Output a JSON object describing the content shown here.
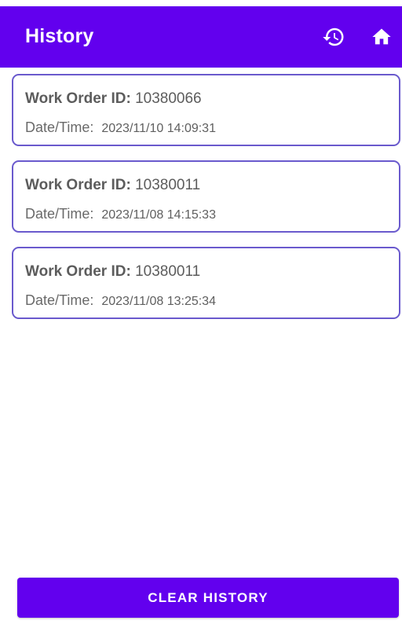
{
  "app_bar": {
    "title": "History",
    "icons": [
      "history-icon",
      "home-icon"
    ],
    "color": "#6200ee"
  },
  "work_orders": [
    {
      "id_label": "Work Order ID:",
      "id_value": "10380066",
      "datetime_label": "Date/Time:",
      "datetime_value": "2023/11/10 14:09:31"
    },
    {
      "id_label": "Work Order ID:",
      "id_value": "10380011",
      "datetime_label": "Date/Time:",
      "datetime_value": "2023/11/08 14:15:33"
    },
    {
      "id_label": "Work Order ID:",
      "id_value": "10380011",
      "datetime_label": "Date/Time:",
      "datetime_value": "2023/11/08 13:25:34"
    }
  ],
  "actions": {
    "clear_history_label": "CLEAR HISTORY"
  },
  "colors": {
    "primary": "#6200ee",
    "card_border": "#6a5acd"
  }
}
